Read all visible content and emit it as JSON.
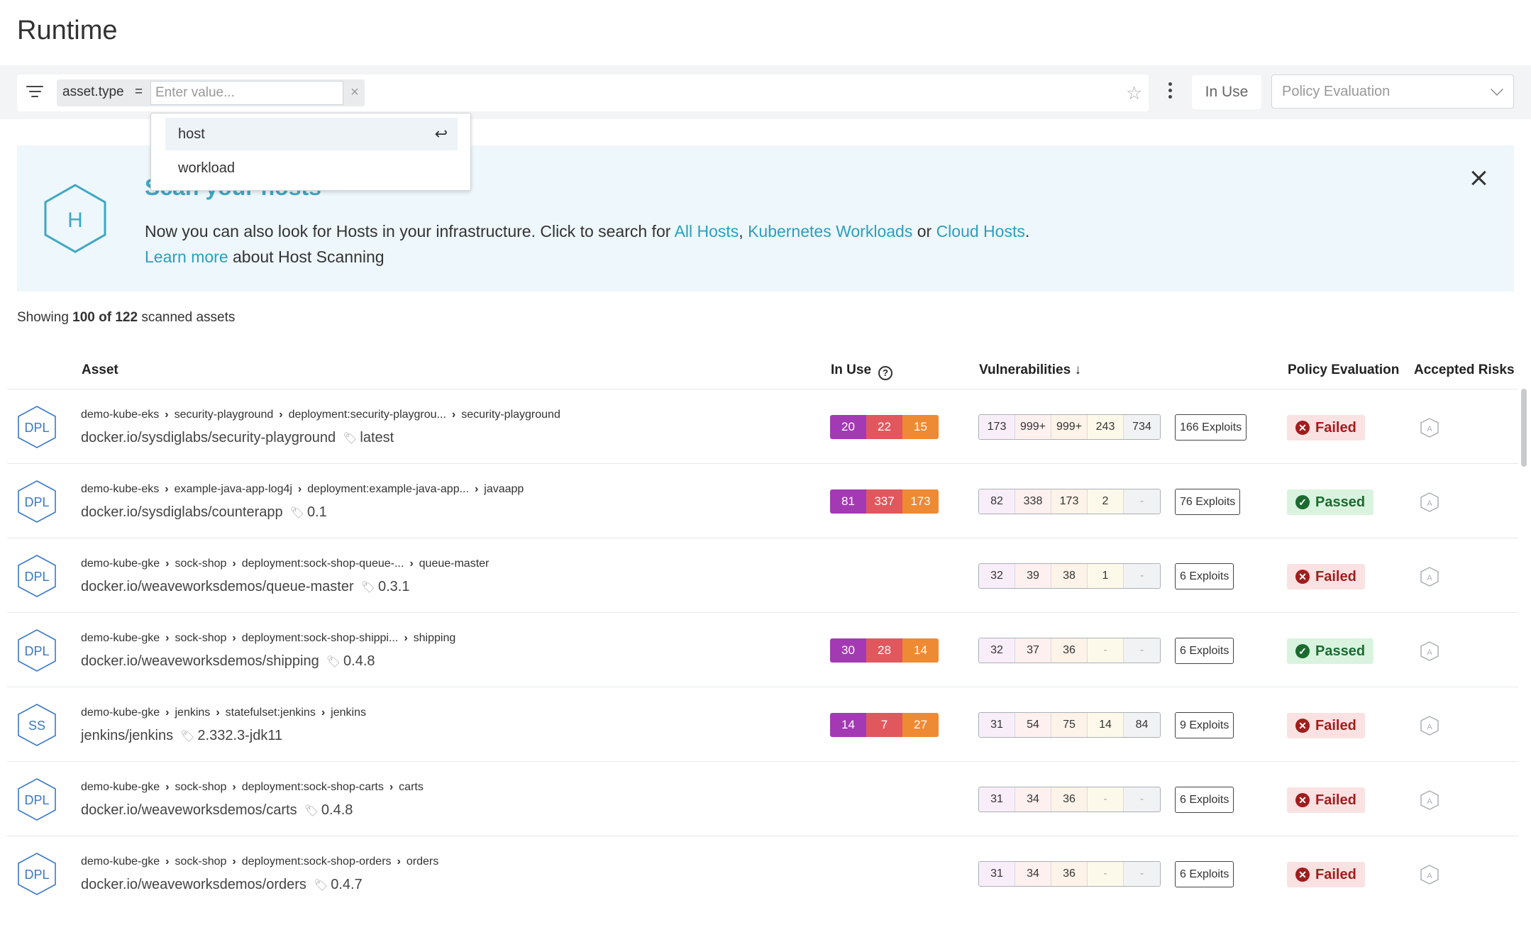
{
  "page": {
    "title": "Runtime"
  },
  "filter": {
    "key": "asset.type",
    "operator": "=",
    "placeholder": "Enter value...",
    "clear": "×",
    "in_use_label": "In Use",
    "policy_placeholder": "Policy Evaluation",
    "dropdown_options": [
      "host",
      "workload"
    ],
    "dropdown_enter_glyph": "↩"
  },
  "banner": {
    "icon_letter": "H",
    "title": "Scan your hosts",
    "line1_prefix": "Now you can also look for Hosts in your infrastructure. Click to search for ",
    "link_all_hosts": "All Hosts",
    "comma": ", ",
    "link_k8s": "Kubernetes Workloads",
    "or": " or ",
    "link_cloud": "Cloud Hosts",
    "period": ".",
    "learn_more": "Learn more",
    "learn_more_suffix": " about Host Scanning"
  },
  "summary": {
    "prefix": "Showing ",
    "count": "100 of 122",
    "suffix": " scanned assets"
  },
  "table": {
    "headers": {
      "asset": "Asset",
      "in_use": "In Use",
      "vulnerabilities": "Vulnerabilities ↓",
      "policy": "Policy Evaluation",
      "accepted_risks": "Accepted Risks"
    },
    "rows": [
      {
        "kind": "DPL",
        "crumbs": [
          "demo-kube-eks",
          "security-playground",
          "deployment:security-playgrou...",
          "security-playground"
        ],
        "image": "docker.io/sysdiglabs/security-playground",
        "tag": "latest",
        "in_use": [
          "20",
          "22",
          "15"
        ],
        "vulns": [
          "173",
          "999+",
          "999+",
          "243",
          "734"
        ],
        "exploits": "166 Exploits",
        "policy": "Failed"
      },
      {
        "kind": "DPL",
        "crumbs": [
          "demo-kube-eks",
          "example-java-app-log4j",
          "deployment:example-java-app...",
          "javaapp"
        ],
        "image": "docker.io/sysdiglabs/counterapp",
        "tag": "0.1",
        "in_use": [
          "81",
          "337",
          "173"
        ],
        "vulns": [
          "82",
          "338",
          "173",
          "2",
          "-"
        ],
        "exploits": "76 Exploits",
        "policy": "Passed"
      },
      {
        "kind": "DPL",
        "crumbs": [
          "demo-kube-gke",
          "sock-shop",
          "deployment:sock-shop-queue-...",
          "queue-master"
        ],
        "image": "docker.io/weaveworksdemos/queue-master",
        "tag": "0.3.1",
        "in_use": [],
        "vulns": [
          "32",
          "39",
          "38",
          "1",
          "-"
        ],
        "exploits": "6 Exploits",
        "policy": "Failed"
      },
      {
        "kind": "DPL",
        "crumbs": [
          "demo-kube-gke",
          "sock-shop",
          "deployment:sock-shop-shippi...",
          "shipping"
        ],
        "image": "docker.io/weaveworksdemos/shipping",
        "tag": "0.4.8",
        "in_use": [
          "30",
          "28",
          "14"
        ],
        "vulns": [
          "32",
          "37",
          "36",
          "-",
          "-"
        ],
        "exploits": "6 Exploits",
        "policy": "Passed"
      },
      {
        "kind": "SS",
        "crumbs": [
          "demo-kube-gke",
          "jenkins",
          "statefulset:jenkins",
          "jenkins"
        ],
        "image": "jenkins/jenkins",
        "tag": "2.332.3-jdk11",
        "in_use": [
          "14",
          "7",
          "27"
        ],
        "vulns": [
          "31",
          "54",
          "75",
          "14",
          "84"
        ],
        "exploits": "9 Exploits",
        "policy": "Failed"
      },
      {
        "kind": "DPL",
        "crumbs": [
          "demo-kube-gke",
          "sock-shop",
          "deployment:sock-shop-carts",
          "carts"
        ],
        "image": "docker.io/weaveworksdemos/carts",
        "tag": "0.4.8",
        "in_use": [],
        "vulns": [
          "31",
          "34",
          "36",
          "-",
          "-"
        ],
        "exploits": "6 Exploits",
        "policy": "Failed"
      },
      {
        "kind": "DPL",
        "crumbs": [
          "demo-kube-gke",
          "sock-shop",
          "deployment:sock-shop-orders",
          "orders"
        ],
        "image": "docker.io/weaveworksdemos/orders",
        "tag": "0.4.7",
        "in_use": [],
        "vulns": [
          "31",
          "34",
          "36",
          "-",
          "-"
        ],
        "exploits": "6 Exploits",
        "policy": "Failed"
      }
    ]
  },
  "colors": {
    "accent_link": "#2a9fbf",
    "critical": "#a33ab4",
    "high": "#e0585e",
    "medium": "#ef8a34",
    "failed": "#a11d1d",
    "passed": "#1c6a30",
    "hex_blue": "#3a78c9"
  },
  "icons": {
    "filter": "filter-lines-icon",
    "star": "star-icon",
    "kebab": "kebab-icon",
    "chevron": "chevron-down-icon",
    "close": "close-icon",
    "help": "help-circle-icon",
    "tag": "tag-icon",
    "risk": "shield-a-icon"
  }
}
